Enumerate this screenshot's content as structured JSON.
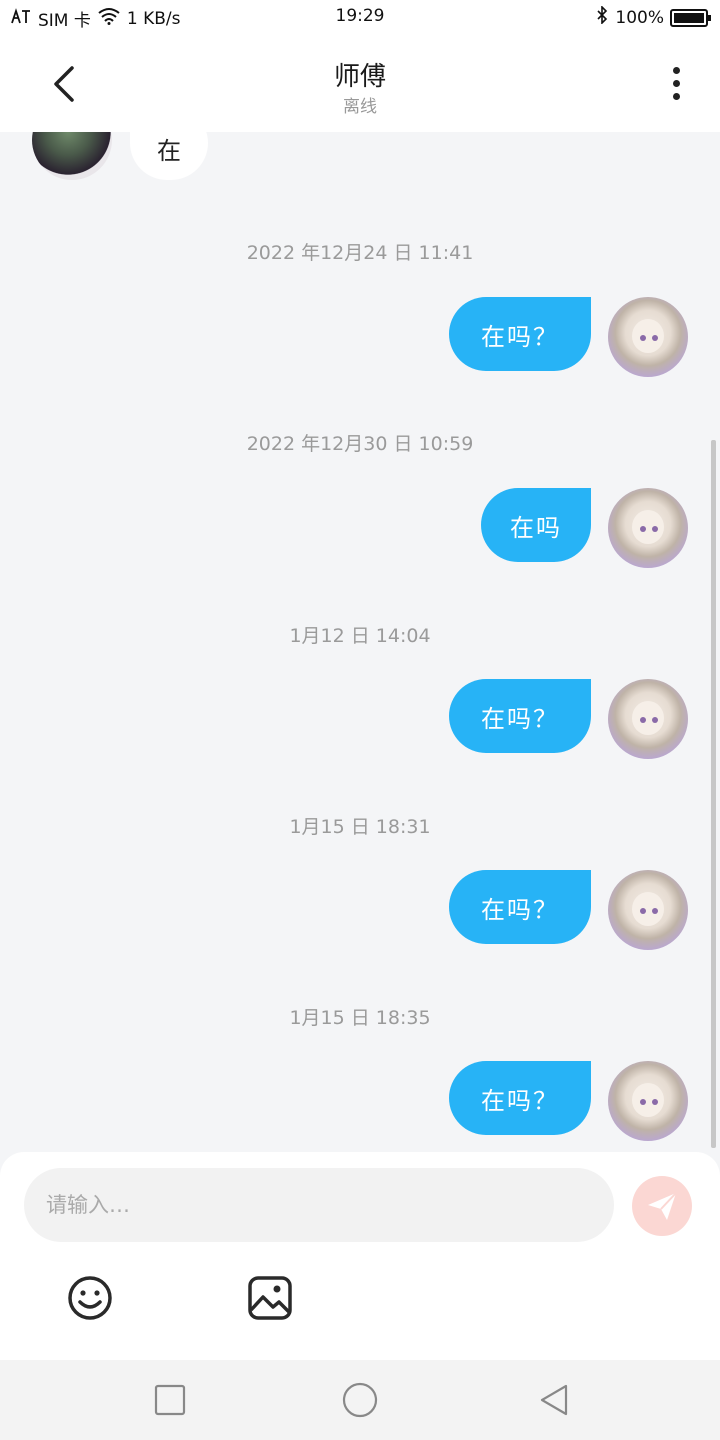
{
  "status_bar": {
    "carrier": "SIM 卡",
    "speed": "1 KB/s",
    "time": "19:29",
    "battery": "100%",
    "battery_level": 1.0
  },
  "header": {
    "title": "师傅",
    "subtitle": "离线"
  },
  "messages": {
    "incoming_partial": "在",
    "items": [
      {
        "time": "2022 年12月24 日 11:41",
        "text": "在吗？"
      },
      {
        "time": "2022 年12月30 日 10:59",
        "text": "在吗"
      },
      {
        "time": "1月12 日 14:04",
        "text": "在吗？"
      },
      {
        "time": "1月15 日 18:31",
        "text": "在吗？"
      },
      {
        "time": "1月15 日 18:35",
        "text": "在吗？"
      }
    ]
  },
  "composer": {
    "placeholder": "请输入…"
  },
  "icons": {
    "back": "chevron-left-icon",
    "more": "more-vertical-icon",
    "send": "send-icon",
    "emoji": "emoji-icon",
    "image": "image-icon",
    "nav_recent": "square-icon",
    "nav_home": "circle-icon",
    "nav_back": "triangle-back-icon"
  },
  "colors": {
    "accent": "#27b3f6",
    "send_disabled": "#fbd7d3"
  }
}
